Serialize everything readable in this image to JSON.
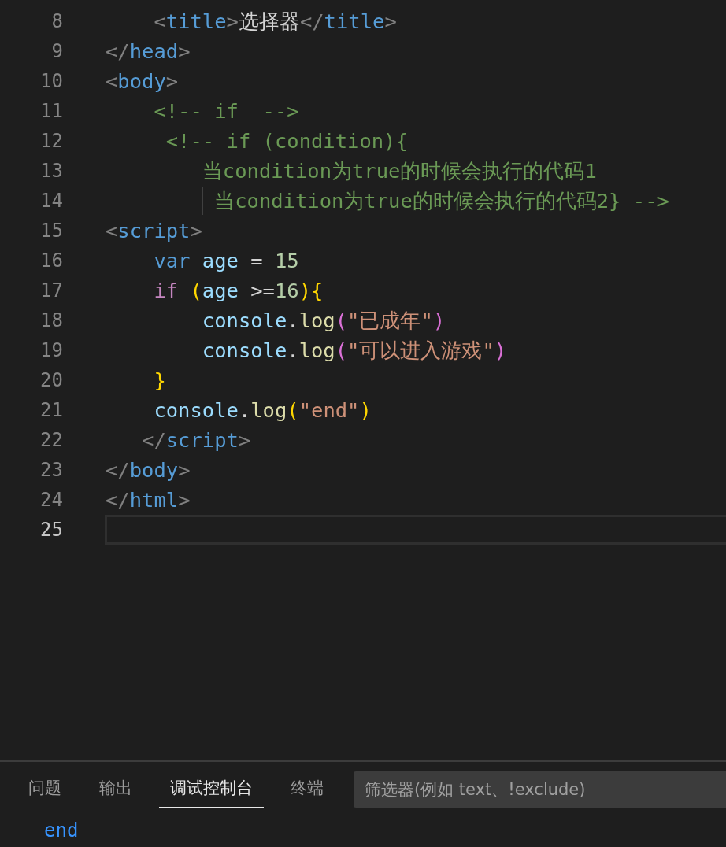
{
  "editor": {
    "lines": [
      {
        "number": "8",
        "active": false,
        "tokens": [
          {
            "kind": "bracket",
            "text": "    <"
          },
          {
            "kind": "tag",
            "text": "title"
          },
          {
            "kind": "bracket",
            "text": ">"
          },
          {
            "kind": "plain",
            "text": "选择器"
          },
          {
            "kind": "bracket",
            "text": "</"
          },
          {
            "kind": "tag",
            "text": "title"
          },
          {
            "kind": "bracket",
            "text": ">"
          }
        ]
      },
      {
        "number": "9",
        "active": false,
        "tokens": [
          {
            "kind": "bracket",
            "text": "</"
          },
          {
            "kind": "tag",
            "text": "head"
          },
          {
            "kind": "bracket",
            "text": ">"
          }
        ]
      },
      {
        "number": "10",
        "active": false,
        "tokens": [
          {
            "kind": "bracket",
            "text": "<"
          },
          {
            "kind": "tag",
            "text": "body"
          },
          {
            "kind": "bracket",
            "text": ">"
          }
        ]
      },
      {
        "number": "11",
        "active": false,
        "tokens": [
          {
            "kind": "comment",
            "text": "    <!-- if  -->"
          }
        ]
      },
      {
        "number": "12",
        "active": false,
        "tokens": [
          {
            "kind": "comment",
            "text": "     <!-- if (condition){"
          }
        ]
      },
      {
        "number": "13",
        "active": false,
        "tokens": [
          {
            "kind": "comment",
            "text": "        当condition为true的时候会执行的代码1"
          }
        ]
      },
      {
        "number": "14",
        "active": false,
        "tokens": [
          {
            "kind": "comment",
            "text": "         当condition为true的时候会执行的代码2} -->"
          }
        ]
      },
      {
        "number": "15",
        "active": false,
        "tokens": [
          {
            "kind": "bracket",
            "text": "<"
          },
          {
            "kind": "tag",
            "text": "script"
          },
          {
            "kind": "bracket",
            "text": ">"
          }
        ]
      },
      {
        "number": "16",
        "active": false,
        "tokens": [
          {
            "kind": "keyword",
            "text": "    var"
          },
          {
            "kind": "variable",
            "text": " age"
          },
          {
            "kind": "plain",
            "text": " = "
          },
          {
            "kind": "number",
            "text": "15"
          }
        ]
      },
      {
        "number": "17",
        "active": false,
        "tokens": [
          {
            "kind": "control",
            "text": "    if "
          },
          {
            "kind": "paren1",
            "text": "("
          },
          {
            "kind": "variable",
            "text": "age"
          },
          {
            "kind": "plain",
            "text": " >="
          },
          {
            "kind": "number",
            "text": "16"
          },
          {
            "kind": "paren1",
            "text": "){"
          }
        ]
      },
      {
        "number": "18",
        "active": false,
        "tokens": [
          {
            "kind": "variable",
            "text": "        console"
          },
          {
            "kind": "plain",
            "text": "."
          },
          {
            "kind": "function",
            "text": "log"
          },
          {
            "kind": "paren2",
            "text": "("
          },
          {
            "kind": "string",
            "text": "\"已成年\""
          },
          {
            "kind": "paren2",
            "text": ")"
          }
        ]
      },
      {
        "number": "19",
        "active": false,
        "tokens": [
          {
            "kind": "variable",
            "text": "        console"
          },
          {
            "kind": "plain",
            "text": "."
          },
          {
            "kind": "function",
            "text": "log"
          },
          {
            "kind": "paren2",
            "text": "("
          },
          {
            "kind": "string",
            "text": "\"可以进入游戏\""
          },
          {
            "kind": "paren2",
            "text": ")"
          }
        ]
      },
      {
        "number": "20",
        "active": false,
        "tokens": [
          {
            "kind": "paren1",
            "text": "    }"
          }
        ]
      },
      {
        "number": "21",
        "active": false,
        "tokens": [
          {
            "kind": "variable",
            "text": "    console"
          },
          {
            "kind": "plain",
            "text": "."
          },
          {
            "kind": "function",
            "text": "log"
          },
          {
            "kind": "paren1",
            "text": "("
          },
          {
            "kind": "string",
            "text": "\"end\""
          },
          {
            "kind": "paren1",
            "text": ")"
          }
        ]
      },
      {
        "number": "22",
        "active": false,
        "tokens": [
          {
            "kind": "bracket",
            "text": "   </"
          },
          {
            "kind": "tag",
            "text": "script"
          },
          {
            "kind": "bracket",
            "text": ">"
          }
        ]
      },
      {
        "number": "23",
        "active": false,
        "tokens": [
          {
            "kind": "bracket",
            "text": "</"
          },
          {
            "kind": "tag",
            "text": "body"
          },
          {
            "kind": "bracket",
            "text": ">"
          }
        ]
      },
      {
        "number": "24",
        "active": false,
        "tokens": [
          {
            "kind": "bracket",
            "text": "</"
          },
          {
            "kind": "tag",
            "text": "html"
          },
          {
            "kind": "bracket",
            "text": ">"
          }
        ]
      },
      {
        "number": "25",
        "active": true
      }
    ]
  },
  "panel": {
    "tabs": [
      {
        "label": "问题",
        "selected": false
      },
      {
        "label": "输出",
        "selected": false
      },
      {
        "label": "调试控制台",
        "selected": true
      },
      {
        "label": "终端",
        "selected": false
      }
    ],
    "filter": {
      "placeholder": "筛选器(例如 text、!exclude)"
    },
    "output": [
      "end"
    ]
  }
}
